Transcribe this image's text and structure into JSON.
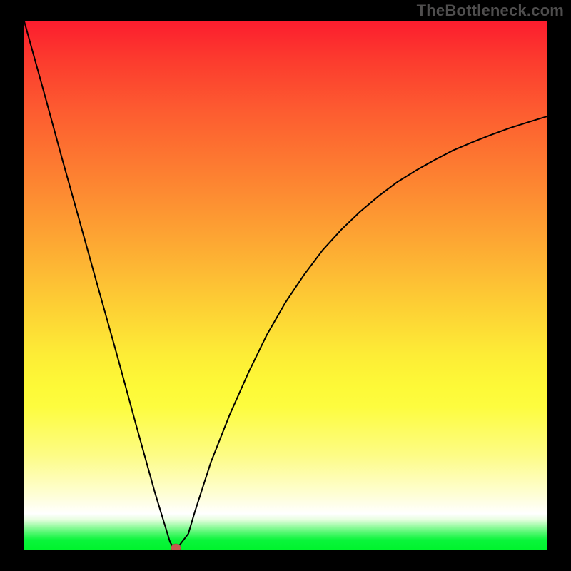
{
  "watermark": {
    "text": "TheBottleneck.com"
  },
  "chart_data": {
    "type": "line",
    "title": "",
    "xlabel": "",
    "ylabel": "",
    "xlim": [
      0,
      100
    ],
    "ylim": [
      0,
      100
    ],
    "grid": false,
    "legend": false,
    "series": [
      {
        "name": "bottleneck-curve",
        "x": [
          0,
          3.6,
          7.1,
          10.7,
          14.3,
          17.9,
          21.4,
          25.0,
          27.9,
          28.6,
          29.3,
          31.4,
          32.6,
          35.7,
          39.3,
          42.9,
          46.4,
          50.0,
          53.6,
          57.1,
          60.7,
          64.3,
          67.9,
          71.4,
          75.0,
          78.6,
          82.1,
          85.7,
          89.3,
          92.9,
          96.4,
          100.0
        ],
        "values": [
          100,
          87.2,
          74.5,
          61.8,
          49.0,
          36.3,
          23.6,
          10.8,
          1.4,
          0.3,
          0.3,
          3.0,
          7.0,
          16.5,
          25.5,
          33.5,
          40.6,
          46.8,
          52.1,
          56.7,
          60.6,
          64.0,
          67.0,
          69.6,
          71.8,
          73.8,
          75.6,
          77.1,
          78.5,
          79.8,
          80.9,
          82.0
        ]
      }
    ],
    "marker": {
      "x": 29.0,
      "y": 0.3
    },
    "background_gradient": {
      "stops": [
        {
          "pct": 0,
          "color": "#fc1d2e"
        },
        {
          "pct": 7,
          "color": "#fc3a2e"
        },
        {
          "pct": 17,
          "color": "#fd5c30"
        },
        {
          "pct": 29,
          "color": "#fd8031"
        },
        {
          "pct": 41,
          "color": "#fda533"
        },
        {
          "pct": 52,
          "color": "#fdc934"
        },
        {
          "pct": 63,
          "color": "#fdec36"
        },
        {
          "pct": 69,
          "color": "#fdf937"
        },
        {
          "pct": 73,
          "color": "#fdfc3f"
        },
        {
          "pct": 82,
          "color": "#fdfc84"
        },
        {
          "pct": 90,
          "color": "#fefed9"
        },
        {
          "pct": 93.2,
          "color": "#ffffff"
        },
        {
          "pct": 94.3,
          "color": "#e8fee1"
        },
        {
          "pct": 95.5,
          "color": "#a0fba9"
        },
        {
          "pct": 96.8,
          "color": "#52f870"
        },
        {
          "pct": 98.2,
          "color": "#0af53b"
        },
        {
          "pct": 100,
          "color": "#00f42d"
        }
      ]
    }
  },
  "colors": {
    "frame": "#000000",
    "curve": "#000000",
    "marker": "#c55a4e"
  }
}
